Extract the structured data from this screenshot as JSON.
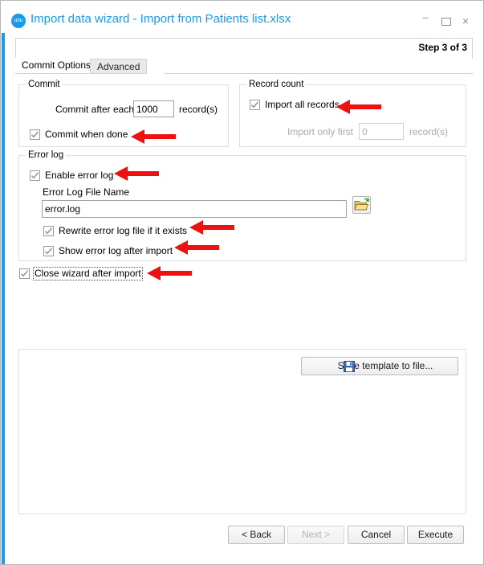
{
  "window": {
    "title": "Import data wizard - Import from Patients list.xlsx",
    "logo_text": "usu",
    "accent_color": "#1a9ae8",
    "controls": {
      "minimize": "–",
      "maximize": "maximize-icon",
      "close": "×"
    }
  },
  "header": {
    "step_label": "Step 3 of 3"
  },
  "tabs": [
    {
      "label": "Commit Options",
      "active": true
    },
    {
      "label": "Advanced",
      "active": false
    }
  ],
  "commit_group": {
    "title": "Commit",
    "commit_after_each_label": "Commit after each",
    "commit_after_each_value": "1000",
    "commit_after_each_suffix": "record(s)",
    "commit_when_done": {
      "label": "Commit when done",
      "checked": true
    }
  },
  "record_count_group": {
    "title": "Record count",
    "import_all_records": {
      "label": "Import all records",
      "checked": true
    },
    "import_only_first_label": "Import only first",
    "import_only_first_value": "0",
    "import_only_first_suffix": "record(s)",
    "import_only_first_enabled": false
  },
  "error_log_group": {
    "title": "Error log",
    "enable_error_log": {
      "label": "Enable error log",
      "checked": true
    },
    "file_name_label": "Error Log File Name",
    "file_name_value": "error.log",
    "browse_icon": "folder-open-icon",
    "rewrite_if_exists": {
      "label": "Rewrite error log file if it exists",
      "checked": true
    },
    "show_after_import": {
      "label": "Show error log after import",
      "checked": true
    }
  },
  "close_wizard_after_import": {
    "label": "Close wizard after import",
    "checked": true,
    "focused": true
  },
  "lower_panel": {
    "save_template_label": "Save template to file...",
    "save_template_icon": "save-disk-icon"
  },
  "footer": {
    "back_label": "< Back",
    "next_label": "Next >",
    "next_enabled": false,
    "cancel_label": "Cancel",
    "execute_label": "Execute"
  },
  "annotations": {
    "arrow_color": "#ee1111",
    "count": 6,
    "targets": [
      "commit-when-done-checkbox",
      "import-all-records-checkbox",
      "enable-error-log-checkbox",
      "rewrite-error-log-checkbox",
      "show-error-log-checkbox",
      "close-wizard-checkbox"
    ]
  }
}
